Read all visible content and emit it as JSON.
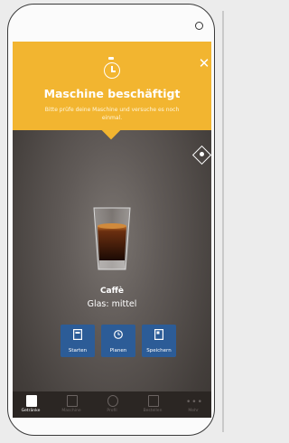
{
  "overlay": {
    "title": "Maschine beschäftigt",
    "message": "Bitte prüfe deine Maschine und versuche es noch einmal."
  },
  "product": {
    "name": "Caffè",
    "detail": "Glas: mittel"
  },
  "actions": [
    {
      "label": "Starten",
      "icon": "start-icon"
    },
    {
      "label": "Planen",
      "icon": "clock-icon"
    },
    {
      "label": "Speichern",
      "icon": "save-icon"
    }
  ],
  "nav": [
    {
      "label": "Getränke",
      "icon": "cup-icon",
      "active": true
    },
    {
      "label": "Maschine",
      "icon": "machine-icon",
      "active": false
    },
    {
      "label": "Profil",
      "icon": "profile-icon",
      "active": false
    },
    {
      "label": "Bestellen",
      "icon": "order-icon",
      "active": false
    },
    {
      "label": "Mehr",
      "icon": "more-icon",
      "active": false
    }
  ],
  "colors": {
    "accent": "#f2b530",
    "button": "#2c5c97",
    "nav_bg": "#2b2623"
  }
}
